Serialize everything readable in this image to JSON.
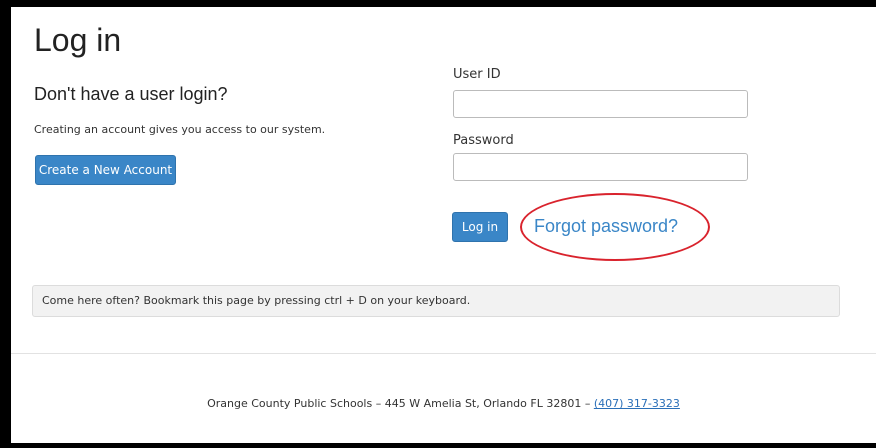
{
  "page": {
    "title": "Log in"
  },
  "signup": {
    "heading": "Don't have a user login?",
    "description": "Creating an account gives you access to our system.",
    "create_button": "Create a New Account"
  },
  "login_form": {
    "user_id_label": "User ID",
    "user_id_value": "",
    "password_label": "Password",
    "password_value": "",
    "login_button": "Log in",
    "forgot_link": "Forgot password?"
  },
  "notice": {
    "text": "Come here often? Bookmark this page by pressing ctrl + D on your keyboard."
  },
  "footer": {
    "text": "Orange County Public Schools – 445 W Amelia St, Orlando FL 32801 – ",
    "phone": "(407) 317-3323"
  },
  "annotation": {
    "highlight_color": "#d9232d"
  }
}
